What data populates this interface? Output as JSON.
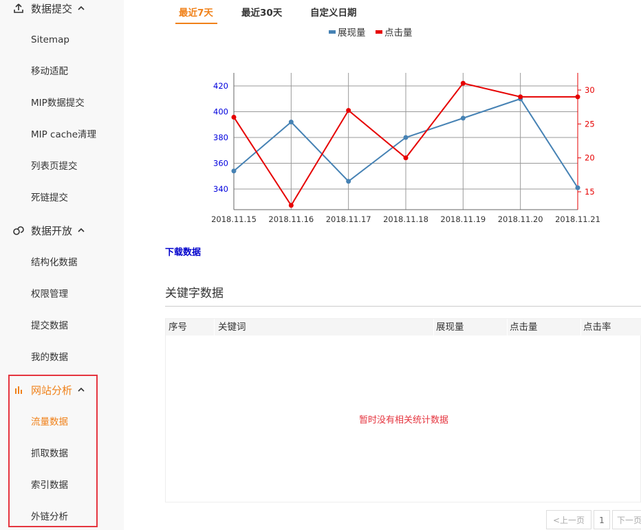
{
  "sidebar": {
    "sections": [
      {
        "label": "数据提交",
        "icon": "upload-icon"
      },
      {
        "label": "数据开放",
        "icon": "link-icon"
      },
      {
        "label": "网站分析",
        "icon": "bar-chart-icon"
      }
    ],
    "items": [
      "Sitemap",
      "移动适配",
      "MIP数据提交",
      "MIP cache清理",
      "列表页提交",
      "死链提交",
      "结构化数据",
      "权限管理",
      "提交数据",
      "我的数据",
      "流量数据",
      "抓取数据",
      "索引数据",
      "外链分析"
    ]
  },
  "tabs": [
    "最近7天",
    "最近30天",
    "自定义日期"
  ],
  "legend": [
    "展现量",
    "点击量"
  ],
  "colors": {
    "accent": "#f08119",
    "impressions": "#4682b4",
    "clicks": "#e60000",
    "highlight": "#e5353f"
  },
  "chart_data": {
    "type": "line",
    "x": [
      "2018.11.15",
      "2018.11.16",
      "2018.11.17",
      "2018.11.18",
      "2018.11.19",
      "2018.11.20",
      "2018.11.21"
    ],
    "series": [
      {
        "name": "展现量",
        "axis": "left",
        "values": [
          354,
          392,
          346,
          380,
          395,
          410,
          341
        ]
      },
      {
        "name": "点击量",
        "axis": "right",
        "values": [
          26,
          13,
          27,
          20,
          31,
          29,
          29
        ]
      }
    ],
    "left_ticks": [
      340,
      360,
      380,
      400,
      420
    ],
    "right_ticks": [
      15,
      20,
      25,
      30
    ],
    "grid": true
  },
  "download_label": "下载数据",
  "keywords": {
    "title": "关键字数据",
    "columns": [
      "序号",
      "关键词",
      "展现量",
      "点击量",
      "点击率"
    ],
    "empty_text": "暂时没有相关统计数据"
  },
  "pagination": {
    "prev": "<上一页",
    "page": "1",
    "next": "下一页"
  }
}
